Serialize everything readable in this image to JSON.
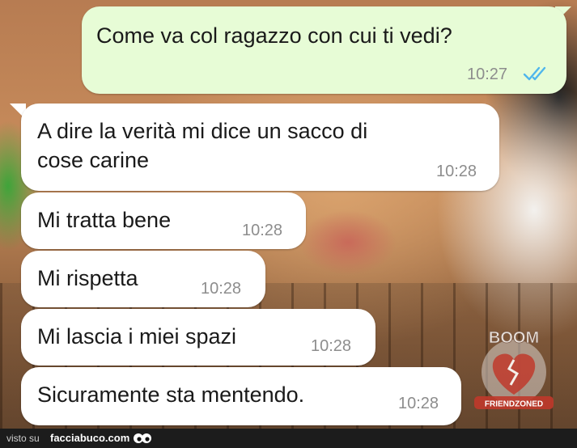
{
  "outgoing": {
    "text": "Come va col ragazzo con cui ti vedi?",
    "time": "10:27",
    "status_icon": "double-check-read-icon",
    "tick_color": "#4fb6ec"
  },
  "incoming": [
    {
      "text": "A dire la verità mi dice un sacco di\ncose carine",
      "time": "10:28"
    },
    {
      "text": "Mi tratta bene",
      "time": "10:28"
    },
    {
      "text": "Mi rispetta",
      "time": "10:28"
    },
    {
      "text": "Mi lascia i miei spazi",
      "time": "10:28"
    },
    {
      "text": "Sicuramente sta mentendo.",
      "time": "10:28"
    }
  ],
  "watermark": {
    "top_text": "BOOM",
    "bottom_text": "FRIENDZONED",
    "icon": "broken-heart-icon"
  },
  "footer": {
    "prefix": "visto su",
    "site": "facciabuco.com",
    "icon": "eyes-icon"
  },
  "colors": {
    "outgoing_bubble": "#e7fcd6",
    "incoming_bubble": "#ffffff",
    "time_text": "#8d8d8d"
  }
}
